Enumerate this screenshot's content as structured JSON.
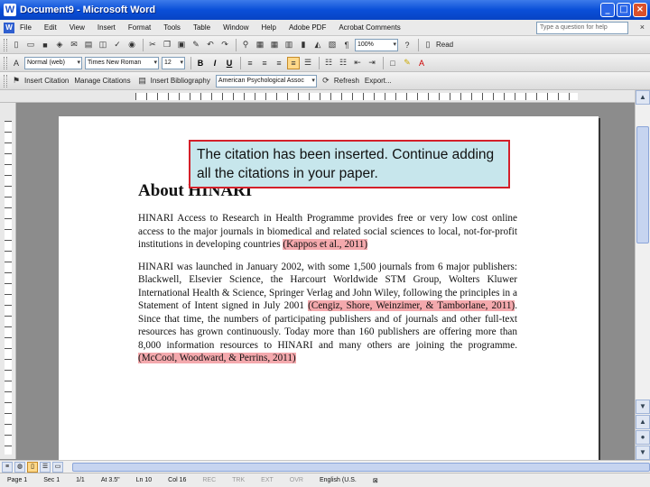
{
  "window": {
    "title": "Document9 - Microsoft Word",
    "app_icon": "W"
  },
  "menu": {
    "items": [
      "File",
      "Edit",
      "View",
      "Insert",
      "Format",
      "Tools",
      "Table",
      "Window",
      "Help",
      "Adobe PDF",
      "Acrobat Comments"
    ],
    "help_placeholder": "Type a question for help"
  },
  "toolbar_standard": {
    "zoom": "100%",
    "read_label": "Read"
  },
  "toolbar_formatting": {
    "style": "Normal (web)",
    "font": "Times New Roman",
    "size": "12"
  },
  "toolbar_endnote": {
    "items": [
      "Insert Citation",
      "Manage Citations",
      "Insert Bibliography"
    ],
    "style_combo": "American Psychological Assoc",
    "refresh": "Refresh",
    "export": "Export..."
  },
  "document": {
    "heading": "About HINARI",
    "p1_text": "HINARI Access to Research in Health Programme provides free or very low cost online access to the major journals in biomedical and related social sciences to local, not-for-profit institutions in developing countries",
    "p1_cite": "(Kappos et al., 2011)",
    "p2_text_a": "HINARI was launched in January 2002, with some 1,500 journals from 6 major publishers: Blackwell, Elsevier Science, the Harcourt Worldwide STM Group, Wolters Kluwer International Health & Science, Springer Verlag and John Wiley, following the principles in a Statement of Intent signed in July 2001",
    "p2_cite_a": "(Cengiz, Shore, Weinzimer, & Tamborlane, 2011)",
    "p2_text_b": ". Since that time, the numbers of participating publishers and of journals and other full-text resources has grown continuously. Today more than 160 publishers are offering more than 8,000 information resources to HINARI and many others are joining the programme.",
    "p2_cite_b": "(McCool, Woodward, & Perrins, 2011)"
  },
  "callout": {
    "text": "The citation has been inserted. Continue adding all the citations in your paper."
  },
  "status": {
    "page": "Page 1",
    "sec": "Sec 1",
    "pages": "1/1",
    "at": "At 3.5\"",
    "ln": "Ln 10",
    "col": "Col 16",
    "rec": "REC",
    "trk": "TRK",
    "ext": "EXT",
    "ovr": "OVR",
    "lang": "English (U.S."
  }
}
